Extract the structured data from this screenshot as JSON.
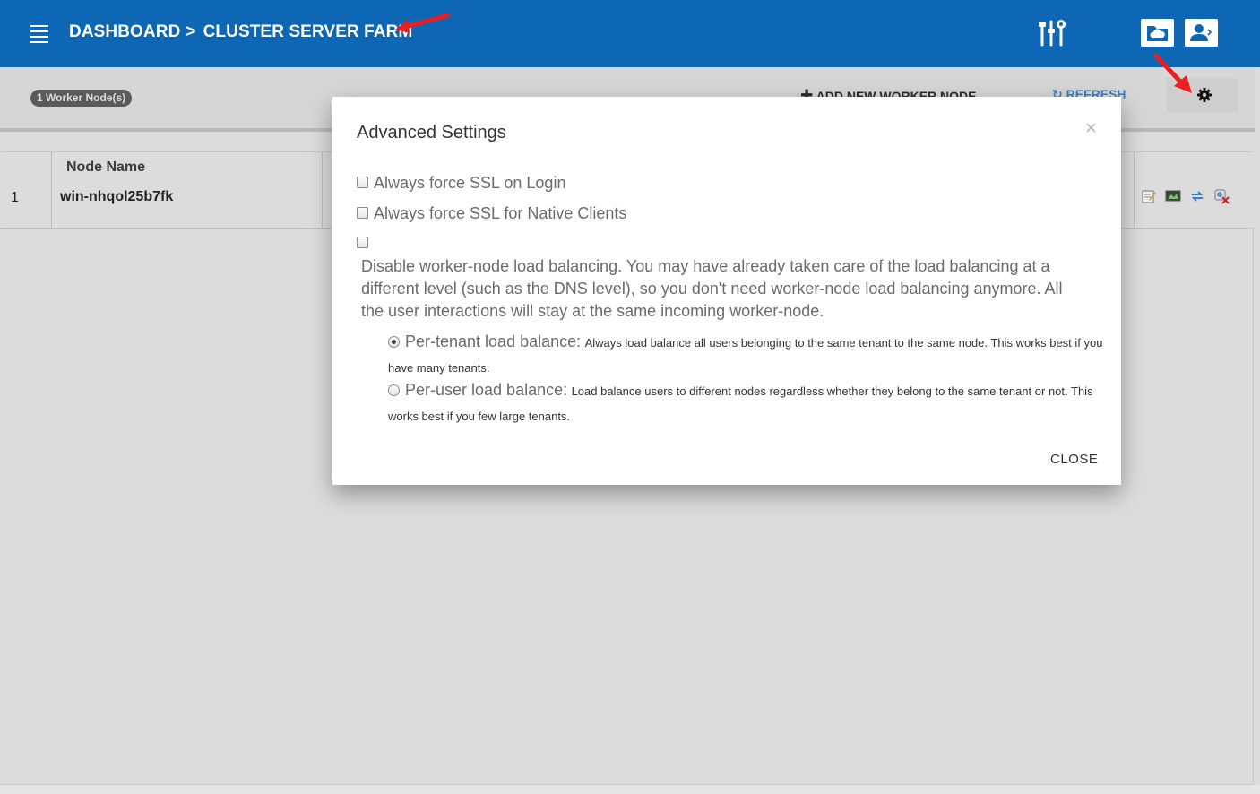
{
  "header": {
    "breadcrumb_root": "DASHBOARD",
    "breadcrumb_separator": ">",
    "breadcrumb_current": "CLUSTER SERVER FARM",
    "bg_color": "#0d67b5"
  },
  "toolbar": {
    "worker_count_badge": "1 Worker Node(s)",
    "add_label": "ADD NEW WORKER NODE",
    "refresh_label": "REFRESH"
  },
  "table": {
    "columns": [
      "Node Name"
    ],
    "rows": [
      {
        "index": "1",
        "name": "win-nhqol25b7fk"
      }
    ]
  },
  "modal": {
    "title": "Advanced Settings",
    "close_x": "×",
    "options": [
      {
        "label": "Always force SSL on Login",
        "checked": false
      },
      {
        "label": "Always force SSL for Native Clients",
        "checked": false
      },
      {
        "label": "",
        "checked": false
      }
    ],
    "disable_lb_description": "Disable worker-node load balancing. You may have already taken care of the load balancing at a different level (such as the DNS level), so you don't need worker-node load balancing anymore. All the user interactions will stay at the same incoming worker-node.",
    "radios": [
      {
        "label": "Per-tenant load balance:",
        "description": "Always load balance all users belonging to the same tenant to the same node. This works best if you have many tenants.",
        "selected": true
      },
      {
        "label": "Per-user load balance:",
        "description": "Load balance users to different nodes regardless whether they belong to the same tenant or not. This works best if you few large tenants.",
        "selected": false
      }
    ],
    "close_button": "CLOSE"
  },
  "annotation_color": "#e8201f"
}
